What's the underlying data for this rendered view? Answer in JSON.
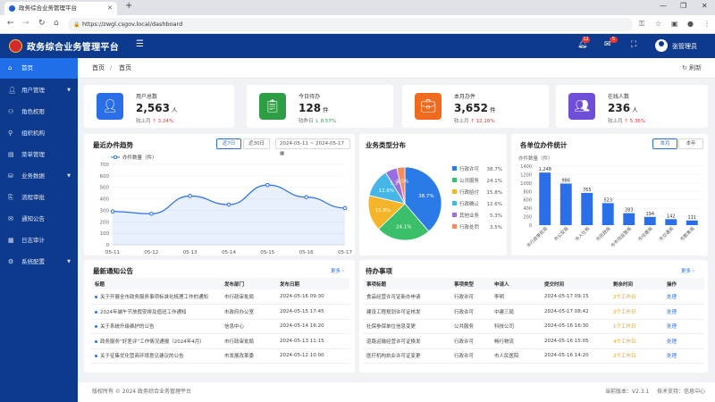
{
  "browser": {
    "tab_title": "政务综合业务管理平台",
    "url": "https://zwgl.csgov.local/dashboard"
  },
  "header": {
    "app_title": "政务综合业务管理平台",
    "notify_count": "12",
    "message_count": "5",
    "user_name": "张管理员"
  },
  "sidebar": {
    "items": [
      {
        "label": "首页",
        "icon": "home-icon"
      },
      {
        "label": "用户管理",
        "icon": "user-icon"
      },
      {
        "label": "角色权限",
        "icon": "role-icon"
      },
      {
        "label": "组织机构",
        "icon": "org-icon"
      },
      {
        "label": "菜单管理",
        "icon": "menu-icon"
      },
      {
        "label": "业务数据",
        "icon": "database-icon"
      },
      {
        "label": "流程审批",
        "icon": "flow-icon"
      },
      {
        "label": "通知公告",
        "icon": "notice-icon"
      },
      {
        "label": "日志审计",
        "icon": "log-icon"
      },
      {
        "label": "系统配置",
        "icon": "gear-icon"
      }
    ]
  },
  "breadcrumb": {
    "root": "首页",
    "sep": "/",
    "current": "首页",
    "refresh": "刷新"
  },
  "stats": [
    {
      "label": "用户总数",
      "value": "2,563",
      "unit": "人",
      "cmp_label": "较上月",
      "cmp_value": "3.24%",
      "dir": "up",
      "color": "#2a6ee8"
    },
    {
      "label": "今日待办",
      "value": "128",
      "unit": "件",
      "cmp_label": "较昨日",
      "cmp_value": "8.57%",
      "dir": "down",
      "color": "#2e9e44"
    },
    {
      "label": "本月办件",
      "value": "3,652",
      "unit": "件",
      "cmp_label": "较上月",
      "cmp_value": "12.18%",
      "dir": "up",
      "color": "#f06b1d"
    },
    {
      "label": "在线人数",
      "value": "236",
      "unit": "人",
      "cmp_label": "较上月",
      "cmp_value": "5.36%",
      "dir": "up",
      "color": "#6f4ed8"
    }
  ],
  "trend": {
    "title": "最近办件趋势",
    "btn_7": "近7日",
    "btn_30": "近30日",
    "date_range": "2024-05-11 ~ 2024-05-17"
  },
  "pie": {
    "title": "业务类型分布"
  },
  "unit_chart": {
    "title": "各单位办件统计",
    "btn_month": "本月",
    "btn_year": "本年"
  },
  "chart_data": [
    {
      "type": "line",
      "legend": "办件数量（件）",
      "x": [
        "05-11",
        "05-12",
        "05-13",
        "05-14",
        "05-15",
        "05-16",
        "05-17"
      ],
      "values": [
        290,
        270,
        425,
        350,
        520,
        415,
        320
      ],
      "ylim": [
        0,
        700
      ],
      "yticks": [
        0,
        100,
        200,
        300,
        400,
        500,
        600,
        700
      ],
      "color": "#2a6ee8"
    },
    {
      "type": "pie",
      "slices": [
        {
          "name": "行政许可",
          "value": 38.7,
          "color": "#2a7be8"
        },
        {
          "name": "公共服务",
          "value": 24.1,
          "color": "#3cbf6b"
        },
        {
          "name": "行政给付",
          "value": 15.8,
          "color": "#f5b52a"
        },
        {
          "name": "行政确认",
          "value": 12.6,
          "color": "#45b6e6"
        },
        {
          "name": "其他业务",
          "value": 5.3,
          "color": "#9b6fe0"
        },
        {
          "name": "行政处罚",
          "value": 3.5,
          "color": "#f28c5b"
        }
      ]
    },
    {
      "type": "bar",
      "ylabel": "办件数量（件）",
      "categories": [
        "市行政审批局",
        "市公安局",
        "市人社局",
        "市民政局",
        "市市场监管局",
        "市住建局",
        "市交通局",
        "市教育局"
      ],
      "values": [
        1248,
        986,
        765,
        523,
        283,
        194,
        142,
        111
      ],
      "ylim": [
        0,
        1400
      ],
      "yticks": [
        0,
        200,
        400,
        600,
        800,
        1000,
        1200,
        1400
      ],
      "color": "#2a6ee8"
    }
  ],
  "notices": {
    "title": "最新通知公告",
    "more": "更多",
    "headers": [
      "标题",
      "发布部门",
      "发布日期"
    ],
    "rows": [
      [
        "关于开展全市政务服务事项标准化梳理工作的通知",
        "市行政审批局",
        "2024-05-16 09:30"
      ],
      [
        "2024年端午节放假安排及值班工作通知",
        "市政府办公室",
        "2024-05-15 17:45"
      ],
      [
        "关于系统升级维护的公告",
        "信息中心",
        "2024-05-14 16:20"
      ],
      [
        "政务服务“好差评”工作情况通报（2024年4月）",
        "市行政审批局",
        "2024-05-13 11:15"
      ],
      [
        "关于征集优化营商环境意见建议的公告",
        "市发展改革委",
        "2024-05-12 10:00"
      ]
    ]
  },
  "todos": {
    "title": "待办事项",
    "more": "更多",
    "headers": [
      "事项标题",
      "事项类型",
      "申请人",
      "提交时间",
      "剩余时间",
      "操作"
    ],
    "rows": [
      [
        "食品经营许可证新办申请",
        "行政许可",
        "李明",
        "2024-05-17 09:15",
        "2个工作日",
        "处理"
      ],
      [
        "建设工程规划许可证核发",
        "行政许可",
        "中建三局",
        "2024-05-17 08:42",
        "3个工作日",
        "处理"
      ],
      [
        "社保参保单位信息变更",
        "公共服务",
        "科技公司",
        "2024-05-16 16:30",
        "1个工作日",
        "处理"
      ],
      [
        "道路运输经营许可证换发",
        "行政许可",
        "畅行物流",
        "2024-05-16 15:05",
        "4个工作日",
        "处理"
      ],
      [
        "医疗机构执业许可证变更",
        "行政许可",
        "市人民医院",
        "2024-05-16 14:20",
        "2个工作日",
        "处理"
      ]
    ]
  },
  "footer": {
    "copyright": "版权所有 © 2024 政务综合业务管理平台",
    "version": "当前版本：V2.3.1",
    "support": "技术支持：信息中心"
  }
}
